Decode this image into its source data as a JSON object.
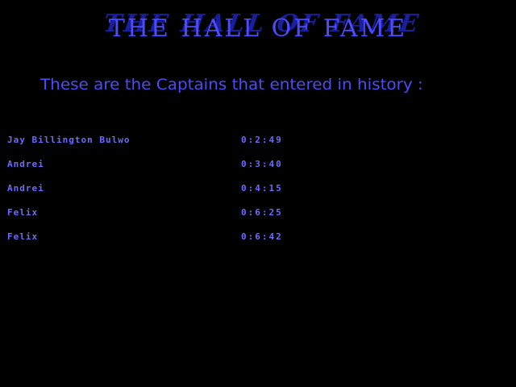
{
  "title": "THE HALL OF FAME",
  "subtitle": "These are the Captains that entered in history :",
  "scores": [
    {
      "name": "Jay Billington Bulwo",
      "time": "0:2:49"
    },
    {
      "name": "Andrei",
      "time": "0:3:40"
    },
    {
      "name": "Andrei",
      "time": "0:4:15"
    },
    {
      "name": "Felix",
      "time": "0:6:25"
    },
    {
      "name": "Felix",
      "time": "0:6:42"
    }
  ],
  "colors": {
    "background": "#000000",
    "text": "#4b4bff",
    "title_shadow": "#1a1fa0",
    "score_text": "#6b6bff"
  }
}
